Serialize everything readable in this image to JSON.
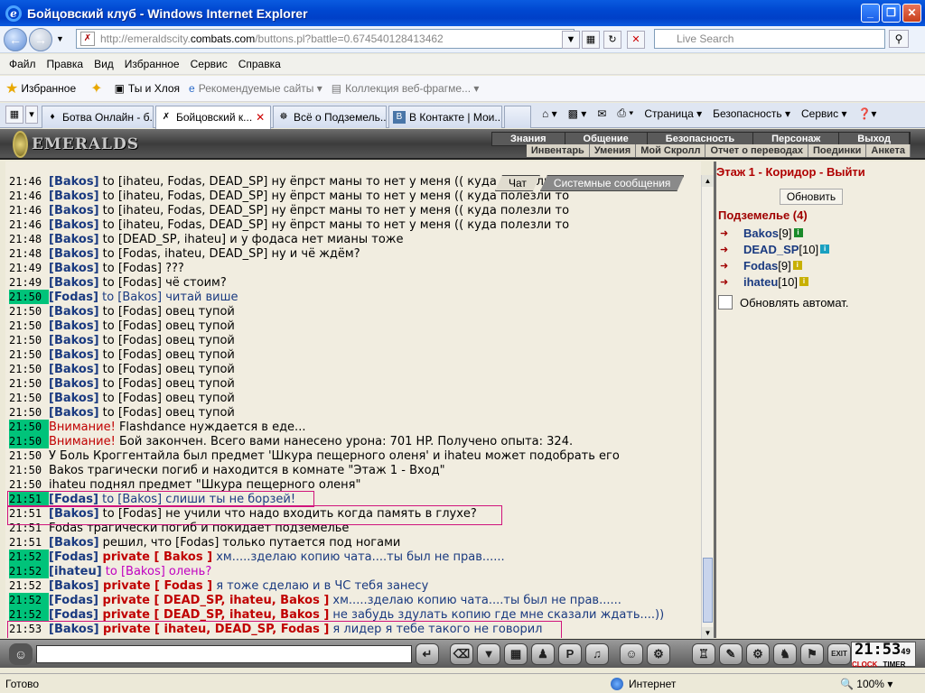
{
  "window": {
    "title": "Бойцовский клуб - Windows Internet Explorer",
    "buttons": [
      "_",
      "❐",
      "✕"
    ]
  },
  "address": {
    "url_prefix": "http://emeraldscity.",
    "url_domain": "combats.com",
    "url_suffix": "/buttons.pl?battle=0.674540128413462",
    "search_placeholder": "Live Search"
  },
  "menu": [
    "Файл",
    "Правка",
    "Вид",
    "Избранное",
    "Сервис",
    "Справка"
  ],
  "favbar": {
    "fav_label": "Избранное",
    "items": [
      "Ты и Хлоя",
      "Рекомендуемые сайты ▾",
      "Коллекция веб-фрагме... ▾"
    ]
  },
  "tabs": [
    "Ботва Онлайн - б...",
    "Бойцовский к...",
    "Всё о Подземель...",
    "В Контакте | Мои..."
  ],
  "commands": [
    "Страница ▾",
    "Безопасность ▾",
    "Сервис ▾"
  ],
  "game_nav": {
    "logo": "EMERALDS",
    "row1": [
      "Знания",
      "Общение",
      "Безопасность",
      "Персонаж",
      "Выход"
    ],
    "row2": [
      "Инвентарь",
      "Умения",
      "Мой Скролл",
      "Отчет о переводах",
      "Поединки",
      "Анкета"
    ]
  },
  "chat_tabs": [
    "Чат",
    "Системные сообщения"
  ],
  "chat": [
    {
      "t": "21:46",
      "hl": false,
      "n": "[Bakos]",
      "m": " to [ihateu, Fodas, DEAD_SP] ну ёпрст маны то нет у меня (( куда полезли то"
    },
    {
      "t": "21:46",
      "hl": false,
      "n": "[Bakos]",
      "m": " to [ihateu, Fodas, DEAD_SP] ну ёпрст маны то нет у меня (( куда полезли то"
    },
    {
      "t": "21:46",
      "hl": false,
      "n": "[Bakos]",
      "m": " to [ihateu, Fodas, DEAD_SP] ну ёпрст маны то нет у меня (( куда полезли то"
    },
    {
      "t": "21:46",
      "hl": false,
      "n": "[Bakos]",
      "m": " to [ihateu, Fodas, DEAD_SP] ну ёпрст маны то нет у меня (( куда полезли то"
    },
    {
      "t": "21:48",
      "hl": false,
      "n": "[Bakos]",
      "m": " to [DEAD_SP, ihateu] и у фодаса нет мианы тоже"
    },
    {
      "t": "21:48",
      "hl": false,
      "n": "[Bakos]",
      "m": " to [Fodas, ihateu, DEAD_SP] ну и чё ждём?"
    },
    {
      "t": "21:49",
      "hl": false,
      "n": "[Bakos]",
      "m": " to [Fodas] ???"
    },
    {
      "t": "21:49",
      "hl": false,
      "n": "[Bakos]",
      "m": " to [Fodas] чё стоим?"
    },
    {
      "t": "21:50",
      "hl": true,
      "n": "[Fodas]",
      "m": " to [Bakos] читай више",
      "c": "pm"
    },
    {
      "t": "21:50",
      "hl": false,
      "n": "[Bakos]",
      "m": " to [Fodas] овец тупой"
    },
    {
      "t": "21:50",
      "hl": false,
      "n": "[Bakos]",
      "m": " to [Fodas] овец тупой"
    },
    {
      "t": "21:50",
      "hl": false,
      "n": "[Bakos]",
      "m": " to [Fodas] овец тупой"
    },
    {
      "t": "21:50",
      "hl": false,
      "n": "[Bakos]",
      "m": " to [Fodas] овец тупой"
    },
    {
      "t": "21:50",
      "hl": false,
      "n": "[Bakos]",
      "m": " to [Fodas] овец тупой"
    },
    {
      "t": "21:50",
      "hl": false,
      "n": "[Bakos]",
      "m": " to [Fodas] овец тупой"
    },
    {
      "t": "21:50",
      "hl": false,
      "n": "[Bakos]",
      "m": " to [Fodas] овец тупой"
    },
    {
      "t": "21:50",
      "hl": false,
      "n": "[Bakos]",
      "m": " to [Fodas] овец тупой"
    },
    {
      "t": "21:50",
      "hl": true,
      "n": "Внимание!",
      "m": " Flashdance нуждается в еде...",
      "c": "note"
    },
    {
      "t": "21:50",
      "hl": true,
      "n": "Внимание!",
      "m": " Бой закончен. Всего вами нанесено урона: 701 HP. Получено опыта: 324.",
      "c": "note"
    },
    {
      "t": "21:50",
      "hl": false,
      "n": "",
      "m": "У Боль Кроггентайла был предмет 'Шкура пещерного оленя' и ihateu может подобрать его"
    },
    {
      "t": "21:50",
      "hl": false,
      "n": "",
      "m": "Bakos трагически погиб и находится в комнате \"Этаж 1 - Вход\""
    },
    {
      "t": "21:50",
      "hl": false,
      "n": "",
      "m": "ihateu поднял предмет \"Шкура пещерного оленя\""
    },
    {
      "t": "21:51",
      "hl": true,
      "n": "[Fodas]",
      "m": " to [Bakos] слиши ты не борзей!",
      "c": "pm"
    },
    {
      "t": "21:51",
      "hl": false,
      "n": "[Bakos]",
      "m": " to [Fodas] не учили что надо входить когда память в глухе?"
    },
    {
      "t": "21:51",
      "hl": false,
      "n": "",
      "m": "Fodas трагически погиб и покидает подземелье"
    },
    {
      "t": "21:51",
      "hl": false,
      "n": "[Bakos]",
      "m": " решил, что [Fodas] только путается под ногами"
    },
    {
      "t": "21:52",
      "hl": true,
      "n": "[Fodas]",
      "m": " private [ Bakos ] хм.....зделаю копию чата....ты был не прав......",
      "c": "priv"
    },
    {
      "t": "21:52",
      "hl": true,
      "n": "[ihateu]",
      "m": " to [Bakos] олень?",
      "c": "pm2"
    },
    {
      "t": "21:52",
      "hl": false,
      "n": "[Bakos]",
      "m": " private [ Fodas ] я тоже сделаю и в ЧС тебя занесу",
      "c": "priv"
    },
    {
      "t": "21:52",
      "hl": true,
      "n": "[Fodas]",
      "m": " private [ DEAD_SP, ihateu, Bakos ] хм.....зделаю копию чата....ты был не прав......",
      "c": "priv"
    },
    {
      "t": "21:52",
      "hl": true,
      "n": "[Fodas]",
      "m": " private [ DEAD_SP, ihateu, Bakos ] не забудь здулать копию где мне сказали ждать....))",
      "c": "priv"
    },
    {
      "t": "21:53",
      "hl": false,
      "n": "[Bakos]",
      "m": " private [ ihateu, DEAD_SP, Fodas ] я лидер я тебе такого не говорил",
      "c": "priv"
    }
  ],
  "side": {
    "location": "Этаж 1 - Коридор - Выйти",
    "refresh": "Обновить",
    "dungeon_title": "Подземелье (4)",
    "players": [
      {
        "name": "Bakos",
        "level": "[9]",
        "info_color": "#1a8a2a"
      },
      {
        "name": "DEAD_SP",
        "level": "[10]",
        "info_color": "#1aa0c0"
      },
      {
        "name": "Fodas",
        "level": "[9]",
        "info_color": "#c8b000"
      },
      {
        "name": "ihateu",
        "level": "[10]",
        "info_color": "#c8b000"
      }
    ],
    "auto_label": "Обновлять автомат."
  },
  "clock": {
    "time": "21:53",
    "sec": "49",
    "clock_label": "CLOCK",
    "timer_label": "TIMER"
  },
  "status": {
    "text": "Готово",
    "zone": "Интернет",
    "zoom": "100%"
  }
}
